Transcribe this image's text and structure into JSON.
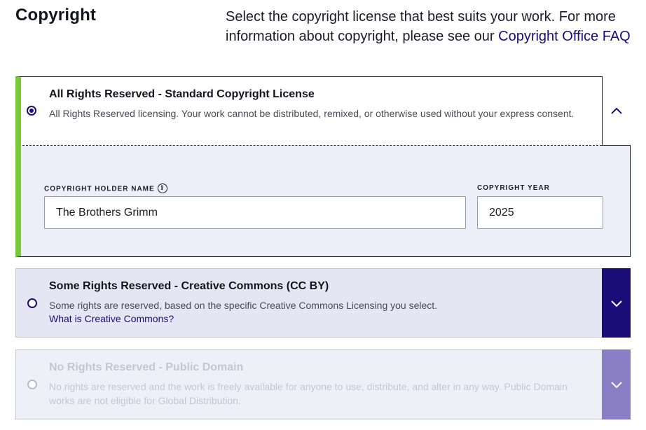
{
  "heading": "Copyright",
  "intro": {
    "text": "Select the copyright license that best suits your work. For more information about copyright, please see our ",
    "link": "Copyright Office FAQ"
  },
  "options": [
    {
      "title": "All Rights Reserved - Standard Copyright License",
      "description": "All Rights Reserved licensing. Your work cannot be distributed, remixed, or otherwise used without your express consent.",
      "selected": true,
      "expanded": true,
      "toggle_icon": "chevron-up-icon"
    },
    {
      "title": "Some Rights Reserved - Creative Commons (CC BY)",
      "description": "Some rights are reserved, based on the specific Creative Commons Licensing you select.",
      "link": "What is Creative Commons?",
      "selected": false,
      "expanded": false,
      "toggle_icon": "chevron-down-icon"
    },
    {
      "title": "No Rights Reserved - Public Domain",
      "description": "No rights are reserved and the work is freely available for anyone to use, distribute, and alter in any way. Public Domain works are not eligible for Global Distribution.",
      "selected": false,
      "disabled": true,
      "expanded": false,
      "toggle_icon": "chevron-down-icon"
    }
  ],
  "fields": {
    "holder_label": "COPYRIGHT HOLDER NAME",
    "holder_value": "The Brothers Grimm",
    "info_icon": "info-icon",
    "year_label": "COPYRIGHT YEAR",
    "year_value": "2025"
  },
  "colors": {
    "accent": "#1a0d78",
    "selected_bar": "#78c93a",
    "disabled_toggle": "#8a7fc7",
    "panel_bg": "#eceef8"
  }
}
